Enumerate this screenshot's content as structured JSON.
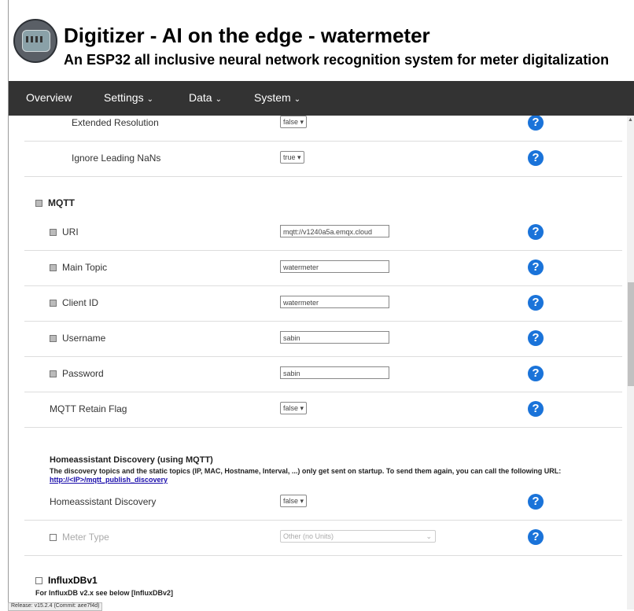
{
  "header": {
    "title": "Digitizer - AI on the edge - watermeter",
    "subtitle": "An ESP32 all inclusive neural network recognition system for meter digitalization"
  },
  "nav": {
    "overview": "Overview",
    "settings": "Settings",
    "data": "Data",
    "system": "System"
  },
  "rows": {
    "extended_resolution": {
      "label": "Extended Resolution",
      "value": "false"
    },
    "ignore_leading_nans": {
      "label": "Ignore Leading NaNs",
      "value": "true"
    },
    "mqtt_section": "MQTT",
    "uri": {
      "label": "URI",
      "value": "mqtt://v1240a5a.emqx.cloud"
    },
    "main_topic": {
      "label": "Main Topic",
      "value": "watermeter"
    },
    "client_id": {
      "label": "Client ID",
      "value": "watermeter"
    },
    "username": {
      "label": "Username",
      "value": "sabin"
    },
    "password": {
      "label": "Password",
      "value": "sabin"
    },
    "retain_flag": {
      "label": "MQTT Retain Flag",
      "value": "false"
    },
    "ha_discovery": {
      "label": "Homeassistant Discovery",
      "value": "false"
    },
    "meter_type": {
      "label": "Meter Type",
      "value": "Other (no Units)"
    }
  },
  "homeassistant": {
    "title": "Homeassistant Discovery (using MQTT)",
    "desc": "The discovery topics and the static topics (IP, MAC, Hostname, Interval, ...) only get sent on startup. To send them again, you can call the following URL:",
    "link": "http://<IP>/mqtt_publish_discovery"
  },
  "influx": {
    "title": "InfluxDBv1",
    "note": "For InfluxDB v2.x see below [InfluxDBv2]"
  },
  "help_glyph": "?",
  "release": "Release: v15.2.4 (Commit: aee7f4d)",
  "colors": {
    "nav_bg": "#333333",
    "help_icon": "#1a73d9"
  }
}
